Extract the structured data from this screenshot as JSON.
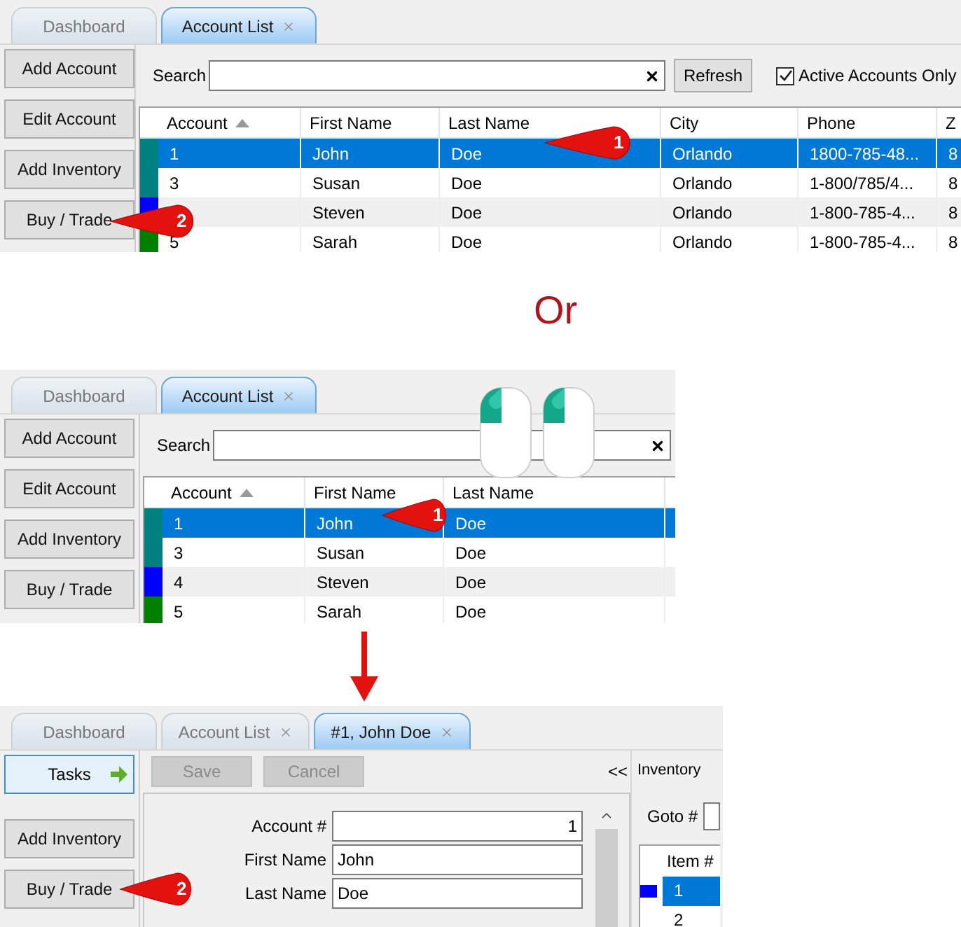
{
  "screenshot_1": {
    "tabs": [
      {
        "label": "Dashboard",
        "selected": false,
        "closable": false
      },
      {
        "label": "Account List",
        "selected": true,
        "closable": true
      }
    ],
    "sidebar_buttons": [
      "Add Account",
      "Edit Account",
      "Add Inventory",
      "Buy / Trade"
    ],
    "search": {
      "label": "Search"
    },
    "refresh_button": "Refresh",
    "active_only": {
      "label": "Active Accounts Only",
      "checked": true
    },
    "table": {
      "columns": [
        {
          "label": "Account",
          "sorted": true
        },
        {
          "label": "First Name",
          "sorted": false
        },
        {
          "label": "Last Name",
          "sorted": false
        },
        {
          "label": "City",
          "sorted": false
        },
        {
          "label": "Phone",
          "sorted": false
        },
        {
          "label": "Z",
          "sorted": false
        }
      ],
      "rows": [
        {
          "color": "#008080",
          "selected": true,
          "account": "1",
          "first_name": "John",
          "last_name": "Doe",
          "city": "Orlando",
          "phone": "1800-785-48...",
          "column_7": "8"
        },
        {
          "color": "#008080",
          "selected": false,
          "account": "3",
          "first_name": "Susan",
          "last_name": "Doe",
          "city": "Orlando",
          "phone": "1-800/785/4...",
          "column_7": "8"
        },
        {
          "color": "#0000ff",
          "selected": false,
          "first_name": "Steven",
          "last_name": "Doe",
          "city": "Orlando",
          "phone": "1-800-785-4...",
          "column_7": "8"
        },
        {
          "color": "#008000",
          "selected": false,
          "account": "5",
          "first_name": "Sarah",
          "last_name": "Doe",
          "city": "Orlando",
          "phone": "1-800-785-4...",
          "column_7": "8"
        }
      ]
    },
    "callouts": [
      "1",
      "2"
    ]
  },
  "separator_text": "Or",
  "screenshot_2": {
    "tabs": [
      {
        "label": "Dashboard",
        "selected": false,
        "closable": false
      },
      {
        "label": "Account List",
        "selected": true,
        "closable": true
      }
    ],
    "sidebar_buttons": [
      "Add Account",
      "Edit Account",
      "Add Inventory",
      "Buy / Trade"
    ],
    "search": {
      "label": "Search"
    },
    "table": {
      "columns": [
        {
          "label": "Account",
          "sorted": true
        },
        {
          "label": "First Name",
          "sorted": false
        },
        {
          "label": "Last Name",
          "sorted": false
        }
      ],
      "rows": [
        {
          "color": "#008080",
          "selected": true,
          "account": "1",
          "first_name": "John",
          "last_name": "Doe"
        },
        {
          "color": "#008080",
          "selected": false,
          "account": "3",
          "first_name": "Susan",
          "last_name": "Doe"
        },
        {
          "color": "#0000ff",
          "selected": false,
          "account": "4",
          "first_name": "Steven",
          "last_name": "Doe"
        },
        {
          "color": "#008000",
          "selected": false,
          "account": "5",
          "first_name": "Sarah",
          "last_name": "Doe"
        }
      ]
    },
    "callouts": [
      "1"
    ]
  },
  "screenshot_3": {
    "tabs": [
      {
        "label": "Dashboard",
        "selected": false,
        "closable": false
      },
      {
        "label": "Account List",
        "selected": false,
        "closable": true
      },
      {
        "label": "#1, John Doe",
        "selected": true,
        "closable": true
      }
    ],
    "sidebar_buttons": [
      {
        "kind": "tasks",
        "label": "Tasks"
      },
      {
        "kind": "plain",
        "label": "Add Inventory"
      },
      {
        "kind": "plain",
        "label": "Buy / Trade"
      }
    ],
    "toolbar": [
      {
        "label": "Save",
        "disabled": true
      },
      {
        "label": "Cancel",
        "disabled": true
      }
    ],
    "collapse_button": "<<",
    "form": [
      {
        "kind": "number",
        "label": "Account #",
        "value": "1"
      },
      {
        "kind": "text",
        "label": "First Name",
        "value": "John"
      },
      {
        "kind": "text",
        "label": "Last Name",
        "value": "Doe"
      }
    ],
    "inventory": {
      "title": "Inventory",
      "goto_label": "Goto #",
      "column": "Item #",
      "rows": [
        {
          "value": "1",
          "selected": true,
          "marker": true
        },
        {
          "value": "2",
          "selected": false,
          "marker": false
        }
      ]
    },
    "callouts": [
      "2"
    ]
  }
}
